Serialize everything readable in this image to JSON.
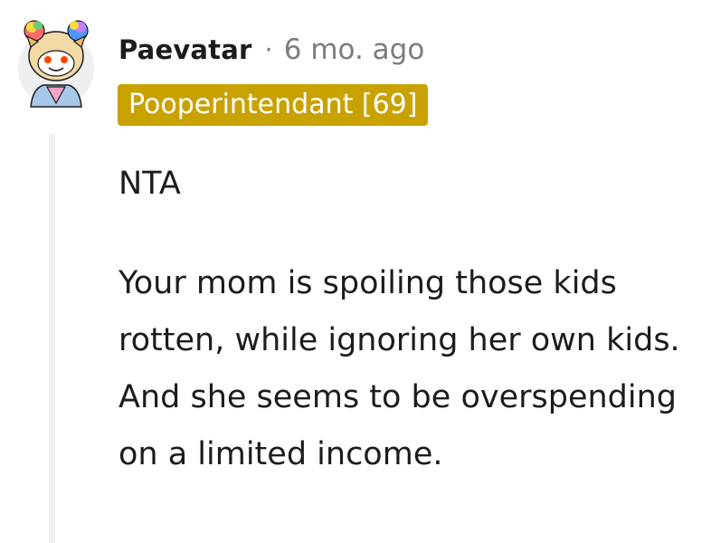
{
  "comment": {
    "author": "Paevatar",
    "separator": "·",
    "timestamp": "6 mo. ago",
    "flair": "Pooperintendant [69]",
    "paragraphs": [
      "NTA",
      "Your mom is spoiling those kids rotten, while ignoring her own kids. And she seems to be overspending on a limited income."
    ]
  },
  "colors": {
    "flair_bg": "#c8a200",
    "flair_text": "#ffffff",
    "meta_text": "#7c7c7c",
    "body_text": "#1c1c1c",
    "thread_line": "#edeff1"
  },
  "icons": {
    "avatar": "snoo-avatar-rainbow-hair"
  }
}
